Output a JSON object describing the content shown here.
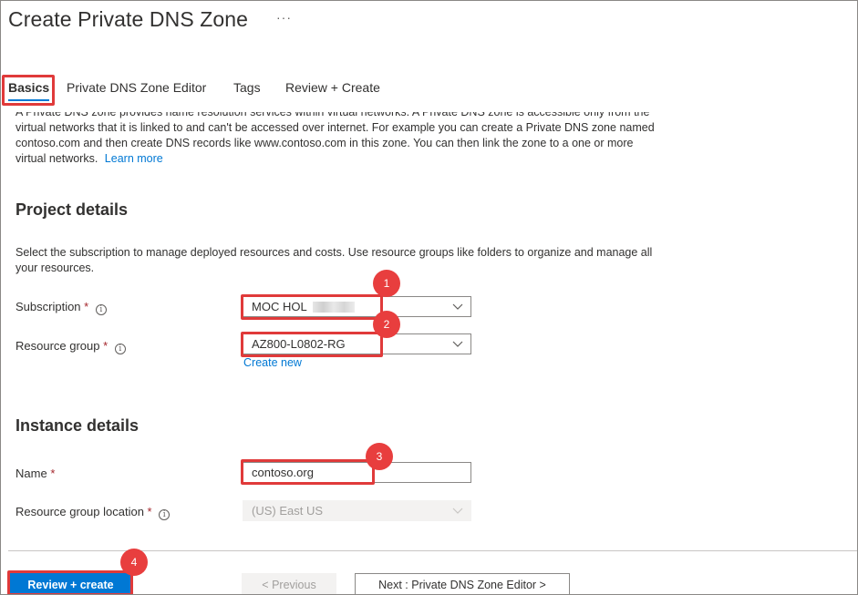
{
  "header": {
    "title": "Create Private DNS Zone",
    "more_label": "···"
  },
  "tabs": [
    {
      "label": "Basics"
    },
    {
      "label": "Private DNS Zone Editor"
    },
    {
      "label": "Tags"
    },
    {
      "label": "Review + Create"
    }
  ],
  "intro": {
    "line1": "A Private DNS zone provides name resolution services within virtual networks. A Private DNS zone is accessible only from the",
    "line2": "virtual networks that it is linked to and can't be accessed over internet. For example you can create a Private DNS zone named",
    "line3": "contoso.com and then create DNS records like www.contoso.com in this zone. You can then link the zone to a one or more",
    "line4": "virtual networks.",
    "learn_more": "Learn more"
  },
  "project": {
    "title": "Project details",
    "desc_line1": "Select the subscription to manage deployed resources and costs. Use resource groups like folders to organize and manage all",
    "desc_line2": "your resources.",
    "subscription_label": "Subscription",
    "subscription_value": "MOC HOL",
    "resource_group_label": "Resource group",
    "resource_group_value": "AZ800-L0802-RG",
    "create_new": "Create new"
  },
  "instance": {
    "title": "Instance details",
    "name_label": "Name",
    "name_value": "contoso.org",
    "location_label": "Resource group location",
    "location_value": "(US) East US"
  },
  "required_marker": "*",
  "info_glyph": "i",
  "annotations": [
    "1",
    "2",
    "3",
    "4"
  ],
  "footer": {
    "review_create": "Review + create",
    "previous": "< Previous",
    "next": "Next : Private DNS Zone Editor >"
  },
  "colors": {
    "accent": "#0078d4",
    "highlight": "#e03a3a",
    "required": "#a4262c"
  },
  "icons": {
    "more": "ellipsis-icon",
    "dropdown": "chevron-down-icon",
    "info": "info-icon"
  }
}
